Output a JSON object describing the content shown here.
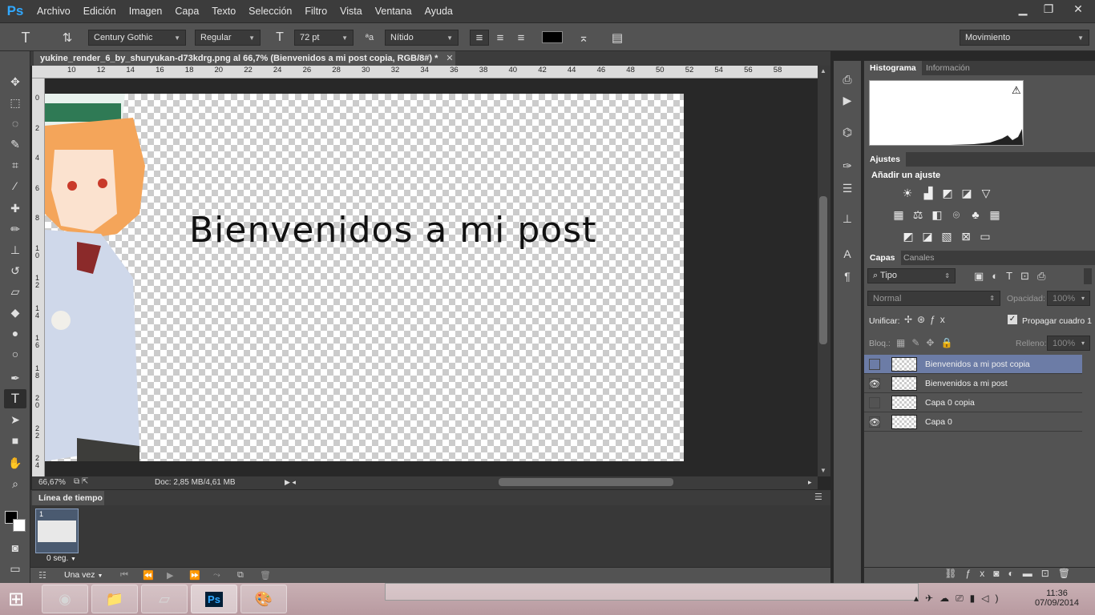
{
  "menubar": {
    "logo": "Ps",
    "items": [
      "Archivo",
      "Edición",
      "Imagen",
      "Capa",
      "Texto",
      "Selección",
      "Filtro",
      "Vista",
      "Ventana",
      "Ayuda"
    ]
  },
  "window_controls": {
    "minimize": "▁",
    "restore": "❐",
    "close": "✕"
  },
  "options": {
    "tool_icon": "T",
    "font_family": "Century Gothic",
    "font_style": "Regular",
    "font_size": "72 pt",
    "antialias_label": "ªa",
    "antialias": "Nítido",
    "workspace": "Movimiento"
  },
  "document": {
    "tab_title": "yukine_render_6_by_shuryukan-d73kdrg.png al 66,7% (Bienvenidos a mi post copia, RGB/8#) *",
    "canvas_text": "Bienvenidos a mi post",
    "zoom": "66,67%",
    "doc_info": "Doc: 2,85 MB/4,61 MB"
  },
  "ruler_top": [
    "10",
    "12",
    "14",
    "16",
    "18",
    "20",
    "22",
    "24",
    "26",
    "28",
    "30",
    "32",
    "34",
    "36",
    "38",
    "40",
    "42",
    "44",
    "46",
    "48",
    "50",
    "52",
    "54",
    "56",
    "58"
  ],
  "ruler_left": [
    "0",
    "2",
    "4",
    "6",
    "8",
    "10",
    "12",
    "14",
    "16",
    "18",
    "20",
    "22",
    "24"
  ],
  "timeline": {
    "tab": "Línea de tiempo",
    "frame_number": "1",
    "frame_time": "0 seg.",
    "loop": "Una vez"
  },
  "panels": {
    "histogram_tab": "Histograma",
    "info_tab": "Información",
    "adjust_tab": "Ajustes",
    "adjust_title": "Añadir un ajuste",
    "layers_tab": "Capas",
    "channels_tab": "Canales",
    "filter_kind": "Tipo",
    "blend_mode": "Normal",
    "opacity_label": "Opacidad:",
    "opacity": "100%",
    "unify_label": "Unificar:",
    "propagate_label": "Propagar cuadro 1",
    "lock_label": "Bloq.:",
    "fill_label": "Relleno:",
    "fill": "100%"
  },
  "layers": [
    {
      "name": "Bienvenidos a mi post copia",
      "visible": false,
      "selected": true
    },
    {
      "name": "Bienvenidos a mi post",
      "visible": true,
      "selected": false
    },
    {
      "name": "Capa 0 copia",
      "visible": false,
      "selected": false
    },
    {
      "name": "Capa 0",
      "visible": true,
      "selected": false
    }
  ],
  "taskbar": {
    "time": "11:36",
    "date": "07/09/2014"
  },
  "colors": {
    "accent": "#31a8ff",
    "selection": "#6c7ca6",
    "panel": "#535353"
  }
}
